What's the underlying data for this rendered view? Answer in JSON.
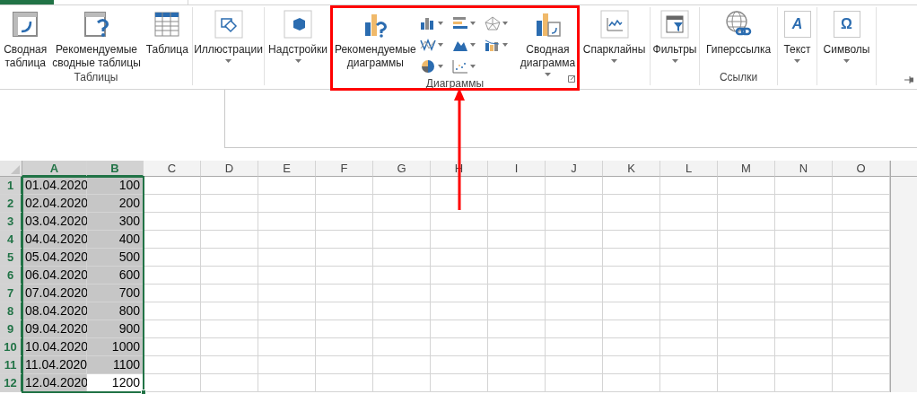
{
  "ribbon": {
    "groups": [
      {
        "label": "Таблицы",
        "highlighted": false,
        "launcher": false,
        "buttons": [
          {
            "kind": "large",
            "label": "Сводная\nтаблица",
            "dropdown": false
          },
          {
            "kind": "large",
            "label": "Рекомендуемые\nсводные таблицы",
            "dropdown": false
          },
          {
            "kind": "large",
            "label": "Таблица",
            "dropdown": false
          }
        ]
      },
      {
        "highlighted": false,
        "launcher": false,
        "buttons": [
          {
            "kind": "large",
            "label": "Иллюстрации",
            "dropdown": true
          }
        ]
      },
      {
        "highlighted": false,
        "launcher": false,
        "buttons": [
          {
            "kind": "large",
            "label": "Надстройки",
            "dropdown": true
          }
        ]
      },
      {
        "label": "Диаграммы",
        "highlighted": true,
        "launcher": true,
        "buttons": [
          {
            "kind": "large",
            "label": "Рекомендуемые\nдиаграммы",
            "dropdown": false
          },
          {
            "kind": "gallery"
          },
          {
            "kind": "large",
            "label": "Сводная\nдиаграмма",
            "dropdown": true
          }
        ]
      },
      {
        "highlighted": false,
        "launcher": false,
        "buttons": [
          {
            "kind": "large",
            "label": "Спарклайны",
            "dropdown": true
          }
        ]
      },
      {
        "highlighted": false,
        "launcher": false,
        "buttons": [
          {
            "kind": "large",
            "label": "Фильтры",
            "dropdown": true
          }
        ]
      },
      {
        "label": "Ссылки",
        "highlighted": false,
        "launcher": false,
        "buttons": [
          {
            "kind": "large",
            "label": "Гиперссылка",
            "dropdown": false
          }
        ]
      },
      {
        "highlighted": false,
        "launcher": false,
        "buttons": [
          {
            "kind": "glyph",
            "glyph": "A",
            "label": "Текст",
            "dropdown": true
          }
        ]
      },
      {
        "highlighted": false,
        "launcher": false,
        "buttons": [
          {
            "kind": "glyph",
            "glyph": "Ω",
            "label": "Символы",
            "dropdown": true
          }
        ]
      }
    ]
  },
  "sheet": {
    "columns": [
      {
        "name": "A",
        "selected": true
      },
      {
        "name": "B",
        "selected": true
      },
      {
        "name": "C",
        "selected": false
      },
      {
        "name": "D",
        "selected": false
      },
      {
        "name": "E",
        "selected": false
      },
      {
        "name": "F",
        "selected": false
      },
      {
        "name": "G",
        "selected": false
      },
      {
        "name": "H",
        "selected": false
      },
      {
        "name": "I",
        "selected": false
      },
      {
        "name": "J",
        "selected": false
      },
      {
        "name": "K",
        "selected": false
      },
      {
        "name": "L",
        "selected": false
      },
      {
        "name": "M",
        "selected": false
      },
      {
        "name": "N",
        "selected": false
      },
      {
        "name": "O",
        "selected": false
      }
    ],
    "rows": [
      {
        "number": "1",
        "selected": true,
        "cells": [
          {
            "value": "01.04.2020",
            "highlighted": true
          },
          {
            "value": "100",
            "highlighted": true
          }
        ]
      },
      {
        "number": "2",
        "selected": true,
        "cells": [
          {
            "value": "02.04.2020",
            "highlighted": true
          },
          {
            "value": "200",
            "highlighted": true
          }
        ]
      },
      {
        "number": "3",
        "selected": true,
        "cells": [
          {
            "value": "03.04.2020",
            "highlighted": true
          },
          {
            "value": "300",
            "highlighted": true
          }
        ]
      },
      {
        "number": "4",
        "selected": true,
        "cells": [
          {
            "value": "04.04.2020",
            "highlighted": true
          },
          {
            "value": "400",
            "highlighted": true
          }
        ]
      },
      {
        "number": "5",
        "selected": true,
        "cells": [
          {
            "value": "05.04.2020",
            "highlighted": true
          },
          {
            "value": "500",
            "highlighted": true
          }
        ]
      },
      {
        "number": "6",
        "selected": true,
        "cells": [
          {
            "value": "06.04.2020",
            "highlighted": true
          },
          {
            "value": "600",
            "highlighted": true
          }
        ]
      },
      {
        "number": "7",
        "selected": true,
        "cells": [
          {
            "value": "07.04.2020",
            "highlighted": true
          },
          {
            "value": "700",
            "highlighted": true
          }
        ]
      },
      {
        "number": "8",
        "selected": true,
        "cells": [
          {
            "value": "08.04.2020",
            "highlighted": true
          },
          {
            "value": "800",
            "highlighted": true
          }
        ]
      },
      {
        "number": "9",
        "selected": true,
        "cells": [
          {
            "value": "09.04.2020",
            "highlighted": true
          },
          {
            "value": "900",
            "highlighted": true
          }
        ]
      },
      {
        "number": "10",
        "selected": true,
        "cells": [
          {
            "value": "10.04.2020",
            "highlighted": true
          },
          {
            "value": "1000",
            "highlighted": true
          }
        ]
      },
      {
        "number": "11",
        "selected": true,
        "cells": [
          {
            "value": "11.04.2020",
            "highlighted": true
          },
          {
            "value": "1100",
            "highlighted": true
          }
        ]
      },
      {
        "number": "12",
        "selected": true,
        "cells": [
          {
            "value": "12.04.2020",
            "highlighted": true
          },
          {
            "value": "1200",
            "highlighted": false
          }
        ]
      }
    ]
  }
}
